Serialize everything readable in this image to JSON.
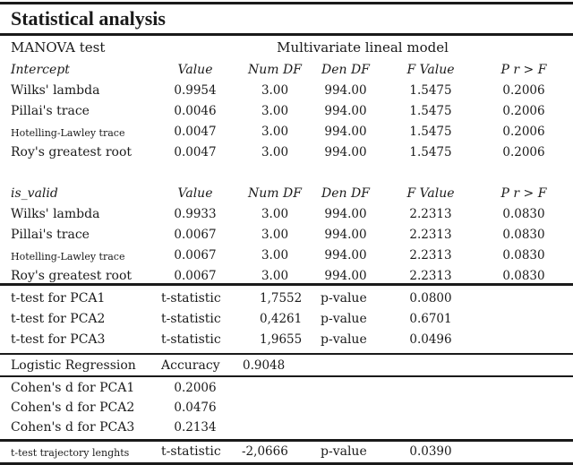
{
  "title": "Statistical analysis",
  "manova": {
    "label": "MANOVA test",
    "model": "Multivariate lineal model",
    "headers": [
      "Value",
      "Num DF",
      "Den DF",
      "F Value",
      "P r > F"
    ],
    "blocks": [
      {
        "effect": "Intercept",
        "rows": [
          {
            "name": "Wilks' lambda",
            "value": "0.9954",
            "num_df": "3.00",
            "den_df": "994.00",
            "f_value": "1.5475",
            "p": "0.2006"
          },
          {
            "name": "Pillai's trace",
            "value": "0.0046",
            "num_df": "3.00",
            "den_df": "994.00",
            "f_value": "1.5475",
            "p": "0.2006"
          },
          {
            "name": "Hotelling-Lawley trace",
            "value": "0.0047",
            "num_df": "3.00",
            "den_df": "994.00",
            "f_value": "1.5475",
            "p": "0.2006"
          },
          {
            "name": "Roy's greatest root",
            "value": "0.0047",
            "num_df": "3.00",
            "den_df": "994.00",
            "f_value": "1.5475",
            "p": "0.2006"
          }
        ]
      },
      {
        "effect": "is_valid",
        "rows": [
          {
            "name": "Wilks' lambda",
            "value": "0.9933",
            "num_df": "3.00",
            "den_df": "994.00",
            "f_value": "2.2313",
            "p": "0.0830"
          },
          {
            "name": "Pillai's trace",
            "value": "0.0067",
            "num_df": "3.00",
            "den_df": "994.00",
            "f_value": "2.2313",
            "p": "0.0830"
          },
          {
            "name": "Hotelling-Lawley trace",
            "value": "0.0067",
            "num_df": "3.00",
            "den_df": "994.00",
            "f_value": "2.2313",
            "p": "0.0830"
          },
          {
            "name": "Roy's greatest root",
            "value": "0.0067",
            "num_df": "3.00",
            "den_df": "994.00",
            "f_value": "2.2313",
            "p": "0.0830"
          }
        ]
      }
    ]
  },
  "ttests": [
    {
      "name": "t-test for PCA1",
      "stat_label": "t-statistic",
      "stat": "1,7552",
      "p_label": "p-value",
      "p": "0.0800"
    },
    {
      "name": "t-test for PCA2",
      "stat_label": "t-statistic",
      "stat": "0,4261",
      "p_label": "p-value",
      "p": "0.6701"
    },
    {
      "name": "t-test for PCA3",
      "stat_label": "t-statistic",
      "stat": "1,9655",
      "p_label": "p-value",
      "p": "0.0496"
    }
  ],
  "logistic": {
    "name": "Logistic Regression",
    "metric": "Accuracy",
    "value": "0.9048"
  },
  "cohens": [
    {
      "name": "Cohen's d for PCA1",
      "value": "0.2006"
    },
    {
      "name": "Cohen's d for PCA2",
      "value": "0.0476"
    },
    {
      "name": "Cohen's d for PCA3",
      "value": "0.2134"
    }
  ],
  "trajectory": {
    "name": "t-test trajectory  lenghts",
    "stat_label": "t-statistic",
    "stat": "-2,0666",
    "p_label": "p-value",
    "p": "0.0390"
  }
}
